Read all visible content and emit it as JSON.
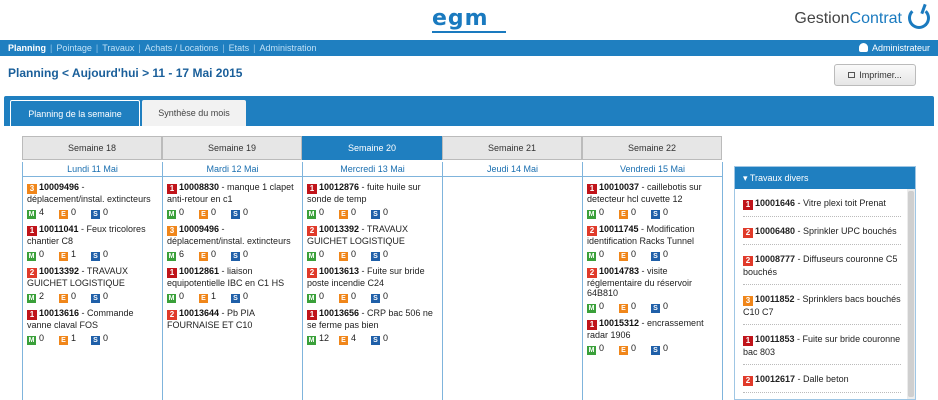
{
  "header": {
    "logo": "egm",
    "brand_part1": "Gestion",
    "brand_part2": "Contrat",
    "brand_color": "#1a7abf"
  },
  "nav": {
    "items": [
      "Planning",
      "Pointage",
      "Travaux",
      "Achats / Locations",
      "Etats",
      "Administration"
    ],
    "active": "Planning",
    "user": "Administrateur"
  },
  "page": {
    "breadcrumb": "Planning  <  Aujourd'hui  >  11 - 17 Mai 2015",
    "print_label": "Imprimer..."
  },
  "tabs": [
    "Planning de la semaine",
    "Synthèse du mois"
  ],
  "weeks": [
    "Semaine 18",
    "Semaine 19",
    "Semaine 20",
    "Semaine 21",
    "Semaine 22"
  ],
  "active_week": "Semaine 20",
  "days": [
    {
      "label": "Lundi 11 Mai",
      "tasks": [
        {
          "prio": "3",
          "num": "10009496",
          "text": " - déplacement/instal. extincteurs",
          "m": "4",
          "e": "0",
          "s": "0"
        },
        {
          "prio": "1",
          "num": "10011041",
          "text": " - Feux tricolores chantier C8",
          "m": "0",
          "e": "1",
          "s": "0"
        },
        {
          "prio": "2",
          "num": "10013392",
          "text": " - TRAVAUX GUICHET LOGISTIQUE",
          "m": "2",
          "e": "0",
          "s": "0"
        },
        {
          "prio": "1",
          "num": "10013616",
          "text": " - Commande vanne claval FOS",
          "m": "0",
          "e": "1",
          "s": "0"
        }
      ]
    },
    {
      "label": "Mardi 12 Mai",
      "tasks": [
        {
          "prio": "1",
          "num": "10008830",
          "text": " - manque 1 clapet anti-retour en c1",
          "m": "0",
          "e": "0",
          "s": "0"
        },
        {
          "prio": "3",
          "num": "10009496",
          "text": " - déplacement/instal. extincteurs",
          "m": "6",
          "e": "0",
          "s": "0"
        },
        {
          "prio": "1",
          "num": "10012861",
          "text": " - liaison equipotentielle IBC en C1 HS",
          "m": "0",
          "e": "1",
          "s": "0"
        },
        {
          "prio": "2",
          "num": "10013644",
          "text": " - Pb PIA FOURNAISE ET C10",
          "m": "",
          "e": "",
          "s": ""
        }
      ]
    },
    {
      "label": "Mercredi 13 Mai",
      "tasks": [
        {
          "prio": "1",
          "num": "10012876",
          "text": " - fuite huile sur sonde de temp",
          "m": "0",
          "e": "0",
          "s": "0"
        },
        {
          "prio": "2",
          "num": "10013392",
          "text": " - TRAVAUX GUICHET LOGISTIQUE",
          "m": "0",
          "e": "0",
          "s": "0"
        },
        {
          "prio": "2",
          "num": "10013613",
          "text": " - Fuite sur bride poste incendie C24",
          "m": "0",
          "e": "0",
          "s": "0"
        },
        {
          "prio": "1",
          "num": "10013656",
          "text": " - CRP bac 506 ne se ferme pas bien",
          "m": "12",
          "e": "4",
          "s": "0"
        }
      ]
    },
    {
      "label": "Jeudi 14 Mai",
      "tasks": []
    },
    {
      "label": "Vendredi 15 Mai",
      "tasks": [
        {
          "prio": "1",
          "num": "10010037",
          "text": " - caillebotis sur detecteur hcl cuvette 12",
          "m": "0",
          "e": "0",
          "s": "0"
        },
        {
          "prio": "2",
          "num": "10011745",
          "text": " - Modification identification Racks Tunnel",
          "m": "0",
          "e": "0",
          "s": "0"
        },
        {
          "prio": "2",
          "num": "10014783",
          "text": " - visite réglementaire du réservoir 64B810",
          "m": "0",
          "e": "0",
          "s": "0"
        },
        {
          "prio": "1",
          "num": "10015312",
          "text": " - encrassement radar 1906",
          "m": "0",
          "e": "0",
          "s": "0"
        }
      ]
    }
  ],
  "sidebar": {
    "title": "Travaux divers",
    "items": [
      {
        "prio": "1",
        "num": "10001646",
        "text": " - Vitre plexi toit Prenat"
      },
      {
        "prio": "2",
        "num": "10006480",
        "text": " - Sprinkler UPC bouchés"
      },
      {
        "prio": "2",
        "num": "10008777",
        "text": " - Diffuseurs couronne C5 bouchés"
      },
      {
        "prio": "3",
        "num": "10011852",
        "text": " - Sprinklers bacs bouchés C10 C7"
      },
      {
        "prio": "1",
        "num": "10011853",
        "text": " - Fuite sur bride couronne bac 803"
      },
      {
        "prio": "2",
        "num": "10012617",
        "text": " - Dalle beton"
      }
    ]
  },
  "badge_letters": {
    "m": "M",
    "e": "E",
    "s": "S"
  },
  "colors": {
    "primary": "#1f7fc0",
    "prio1": "#c0141a",
    "prio2": "#e03a2a",
    "prio3": "#f0861a",
    "m": "#3aa03a",
    "e": "#f0861a",
    "s": "#1f5fa8"
  }
}
